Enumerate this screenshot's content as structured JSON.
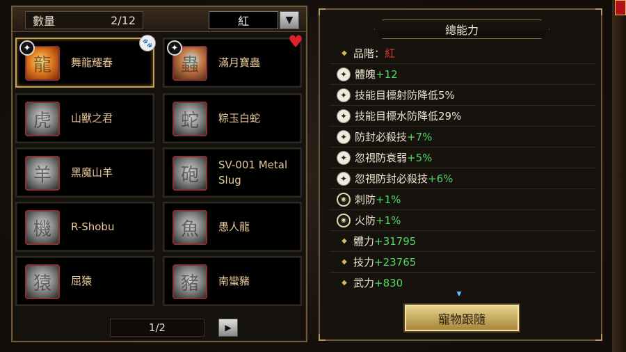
{
  "header": {
    "count_label": "數量",
    "count_value": "2/12",
    "filter_value": "紅",
    "filter_arrow": "▼"
  },
  "pets": [
    {
      "name": "舞龍耀春",
      "icon": "dragon-icon",
      "selected": true,
      "badge": "paw-icon"
    },
    {
      "name": "滿月寶蟲",
      "icon": "beetle-icon",
      "selected": false,
      "badge": "heart-icon"
    },
    {
      "name": "山獸之君",
      "icon": "tiger-icon"
    },
    {
      "name": "粽玉白蛇",
      "icon": "snake-icon"
    },
    {
      "name": "黑魔山羊",
      "icon": "goat-icon"
    },
    {
      "name": "SV-001 Metal Slug",
      "icon": "tank-icon"
    },
    {
      "name": "R-Shobu",
      "icon": "plane-icon"
    },
    {
      "name": "愚人龍",
      "icon": "fish-dragon-icon"
    },
    {
      "name": "屈猿",
      "icon": "monkey-icon"
    },
    {
      "name": "南蠻豬",
      "icon": "pig-icon"
    }
  ],
  "pager": {
    "text": "1/2",
    "next": "▶"
  },
  "stats_panel": {
    "title": "總能力",
    "grade_label": "品階：",
    "grade_value": "紅",
    "rows": [
      {
        "icon": "star-icon",
        "label": "體魄",
        "value": "+12"
      },
      {
        "icon": "star-icon",
        "label": "技能目標射防降低5%",
        "value": ""
      },
      {
        "icon": "star-icon",
        "label": "技能目標水防降低29%",
        "value": ""
      },
      {
        "icon": "star-icon",
        "label": "防封必殺技",
        "value": "+7%"
      },
      {
        "icon": "star-icon",
        "label": "忽視防衰弱",
        "value": "+5%"
      },
      {
        "icon": "star-icon",
        "label": "忽視防封必殺技",
        "value": "+6%"
      },
      {
        "icon": "ring-icon",
        "label": "刺防",
        "value": "+1%"
      },
      {
        "icon": "ring-icon",
        "label": "火防",
        "value": "+1%"
      },
      {
        "icon": "diamond-icon",
        "label": "體力",
        "value": "+31795"
      },
      {
        "icon": "diamond-icon",
        "label": "技力",
        "value": "+23765"
      },
      {
        "icon": "diamond-icon",
        "label": "武力",
        "value": "+830"
      }
    ],
    "follow_button": "寵物跟隨"
  },
  "colors": {
    "gold_border": "#c9a455",
    "stat_green": "#4fd860",
    "grade_red": "#e23a2a"
  }
}
